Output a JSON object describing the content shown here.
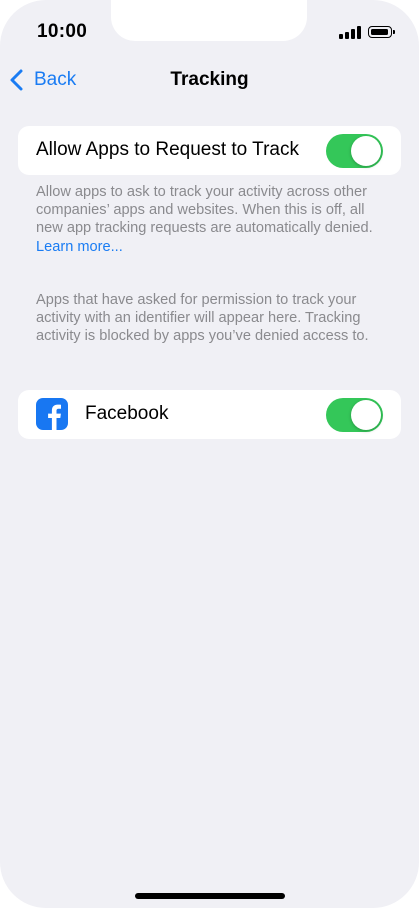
{
  "status_bar": {
    "time": "10:00"
  },
  "nav": {
    "back_label": "Back",
    "title": "Tracking"
  },
  "allow_tracking": {
    "label": "Allow Apps to Request to Track",
    "enabled": true,
    "footer_text": "Allow apps to ask to track your activity across other companies’ apps and websites. When this is off, all new app tracking requests are automatically denied. ",
    "learn_more": "Learn more..."
  },
  "apps_section": {
    "description": "Apps that have asked for permission to track your activity with an identifier will appear here. Tracking activity is blocked by apps you’ve denied access to.",
    "apps": [
      {
        "name": "Facebook",
        "icon": "facebook-icon",
        "enabled": true
      }
    ]
  },
  "colors": {
    "background": "#f0f0f5",
    "accent": "#1a7cf3",
    "toggle_on": "#34c759",
    "secondary_text": "#8a8a8e",
    "facebook": "#1877f2"
  }
}
